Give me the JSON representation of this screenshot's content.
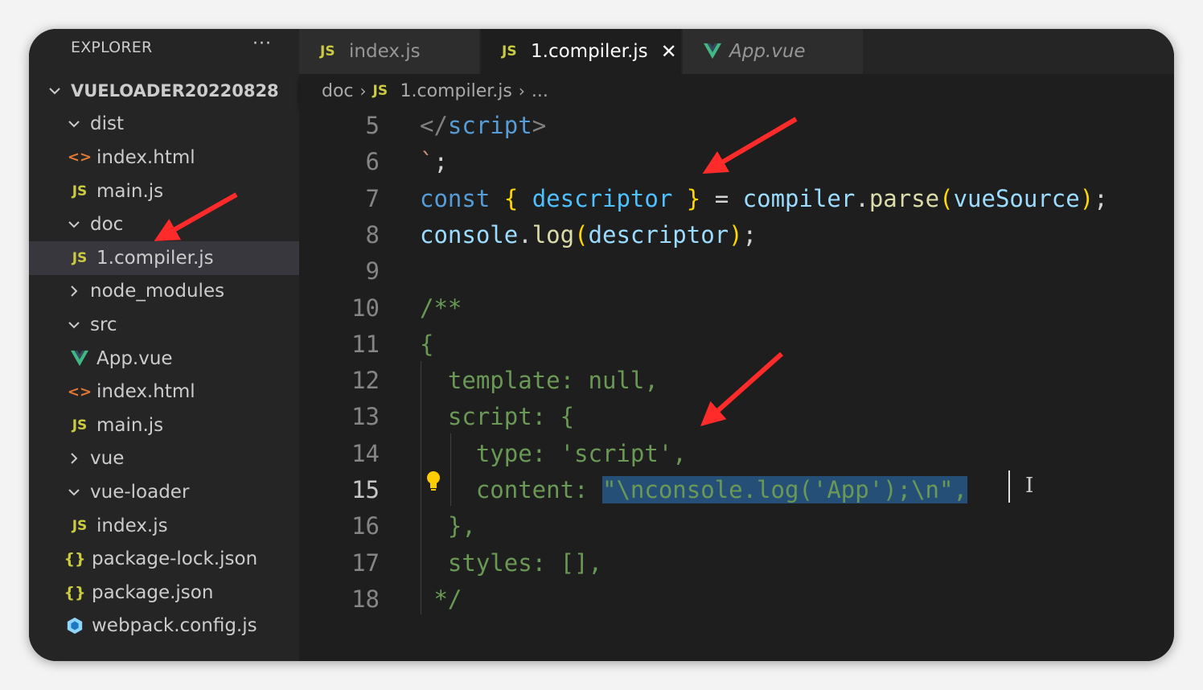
{
  "sidebar": {
    "header": "EXPLORER",
    "more": "···",
    "tree": [
      {
        "label": "VUELOADER20220828",
        "type": "root",
        "indent": 0
      },
      {
        "label": "dist",
        "type": "folder-open",
        "indent": 1
      },
      {
        "label": "index.html",
        "type": "html",
        "indent": 2
      },
      {
        "label": "main.js",
        "type": "js",
        "indent": 2
      },
      {
        "label": "doc",
        "type": "folder-open",
        "indent": 1
      },
      {
        "label": "1.compiler.js",
        "type": "js",
        "indent": 2,
        "selected": true
      },
      {
        "label": "node_modules",
        "type": "folder-closed",
        "indent": 1
      },
      {
        "label": "src",
        "type": "folder-open",
        "indent": 1
      },
      {
        "label": "App.vue",
        "type": "vue",
        "indent": 2
      },
      {
        "label": "index.html",
        "type": "html",
        "indent": 2
      },
      {
        "label": "main.js",
        "type": "js",
        "indent": 2
      },
      {
        "label": "vue",
        "type": "folder-closed",
        "indent": 1
      },
      {
        "label": "vue-loader",
        "type": "folder-open",
        "indent": 1
      },
      {
        "label": "index.js",
        "type": "js",
        "indent": 2
      },
      {
        "label": "package-lock.json",
        "type": "json",
        "indent": 1
      },
      {
        "label": "package.json",
        "type": "json",
        "indent": 1
      },
      {
        "label": "webpack.config.js",
        "type": "webpack",
        "indent": 1
      }
    ]
  },
  "icons": {
    "js": "JS",
    "html": "<>",
    "json": "{}",
    "vue": "vue-logo-icon",
    "webpack": "webpack-cube-icon",
    "chevron_down": "chevron-down-icon",
    "chevron_right": "chevron-right-icon"
  },
  "tabs": [
    {
      "label": "index.js",
      "icon": "js",
      "active": false
    },
    {
      "label": "1.compiler.js",
      "icon": "js",
      "active": true,
      "close": "✕"
    },
    {
      "label": "App.vue",
      "icon": "vue",
      "active": false
    }
  ],
  "breadcrumb": {
    "folder": "doc",
    "file": "1.compiler.js",
    "more": "..."
  },
  "editor": {
    "lines": [
      {
        "n": "5",
        "tokens": [
          [
            "c-tag",
            "</"
          ],
          [
            "c-tagname",
            "script"
          ],
          [
            "c-tag",
            ">"
          ]
        ],
        "indent": 0
      },
      {
        "n": "6",
        "tokens": [
          [
            "c-str",
            "`"
          ],
          [
            "",
            "; "
          ]
        ],
        "indent": 0
      },
      {
        "n": "7",
        "tokens": [
          [
            "c-kw",
            "const"
          ],
          [
            "",
            " "
          ],
          [
            "c-brace",
            "{"
          ],
          [
            "",
            " "
          ],
          [
            "c-var",
            "descriptor"
          ],
          [
            "",
            " "
          ],
          [
            "c-brace",
            "}"
          ],
          [
            "",
            " = "
          ],
          [
            "c-id",
            "compiler"
          ],
          [
            "",
            "."
          ],
          [
            "c-fn",
            "parse"
          ],
          [
            "c-brace",
            "("
          ],
          [
            "c-id",
            "vueSource"
          ],
          [
            "c-brace",
            ")"
          ],
          [
            "",
            ";"
          ]
        ],
        "indent": 0
      },
      {
        "n": "8",
        "tokens": [
          [
            "c-id",
            "console"
          ],
          [
            "",
            "."
          ],
          [
            "c-fn",
            "log"
          ],
          [
            "c-brace",
            "("
          ],
          [
            "c-id",
            "descriptor"
          ],
          [
            "c-brace",
            ")"
          ],
          [
            "",
            ";"
          ]
        ],
        "indent": 0
      },
      {
        "n": "9",
        "tokens": [],
        "indent": 0
      },
      {
        "n": "10",
        "tokens": [
          [
            "c-comment",
            "/**"
          ]
        ],
        "indent": 0
      },
      {
        "n": "11",
        "tokens": [
          [
            "c-comment",
            "{"
          ]
        ],
        "indent": 0
      },
      {
        "n": "12",
        "tokens": [
          [
            "c-comment",
            "  template: null,"
          ]
        ],
        "indent": 0
      },
      {
        "n": "13",
        "tokens": [
          [
            "c-comment",
            "  script: {"
          ]
        ],
        "indent": 0
      },
      {
        "n": "14",
        "tokens": [
          [
            "c-comment",
            "    type: 'script',"
          ]
        ],
        "indent": 0
      },
      {
        "n": "15",
        "tokens": [
          [
            "c-comment",
            "    content: "
          ],
          [
            "c-sel",
            "\"\\nconsole.log('App');\\n\","
          ]
        ],
        "indent": 0,
        "current": true
      },
      {
        "n": "16",
        "tokens": [
          [
            "c-comment",
            "  },"
          ]
        ],
        "indent": 0
      },
      {
        "n": "17",
        "tokens": [
          [
            "c-comment",
            "  styles: [],"
          ]
        ],
        "indent": 0
      },
      {
        "n": "18",
        "tokens": [
          [
            "c-comment",
            " */"
          ]
        ],
        "indent": 0
      }
    ]
  },
  "colors": {
    "accent_arrow": "#ff2a2a",
    "selection": "#264f78",
    "bulb": "#ffcc00"
  }
}
